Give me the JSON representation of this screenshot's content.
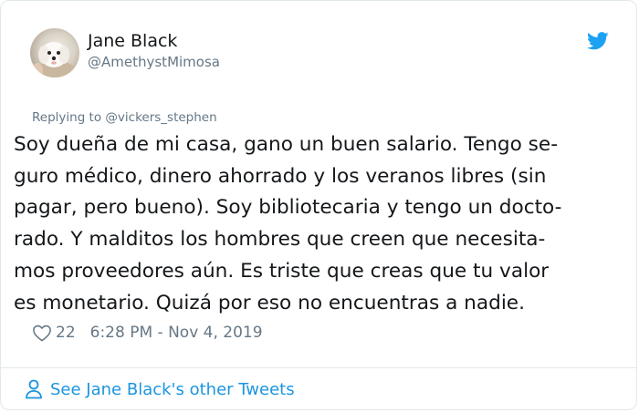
{
  "user": {
    "name": "Jane Black",
    "handle": "@AmethystMimosa"
  },
  "reply": {
    "text": "Replying to @vickers_stephen"
  },
  "tweet": {
    "lines": [
      "Soy dueña de mi casa, gano un buen salario. Tengo se-",
      "guro médico, dinero ahorrado y los veranos libres (sin",
      "pagar, pero bueno). Soy bibliotecaria y tengo un docto-",
      "rado. Y malditos los hombres que creen que necesita-",
      "mos proveedores aún. Es triste que creas que tu valor",
      "es monetario. Quizá por eso no encuentras a nadie."
    ],
    "likes": "22",
    "timestamp": "6:28 PM - Nov 4, 2019"
  },
  "footer": {
    "link_label": "See Jane Black's other Tweets"
  },
  "icons": {
    "brand": "twitter-bird-icon",
    "like": "heart-icon",
    "profile": "person-icon"
  },
  "colors": {
    "brand_blue": "#1da1f2",
    "link_blue": "#1b95e0",
    "muted_gray": "#657786",
    "text": "#14171a",
    "border": "#e1e8ed"
  }
}
